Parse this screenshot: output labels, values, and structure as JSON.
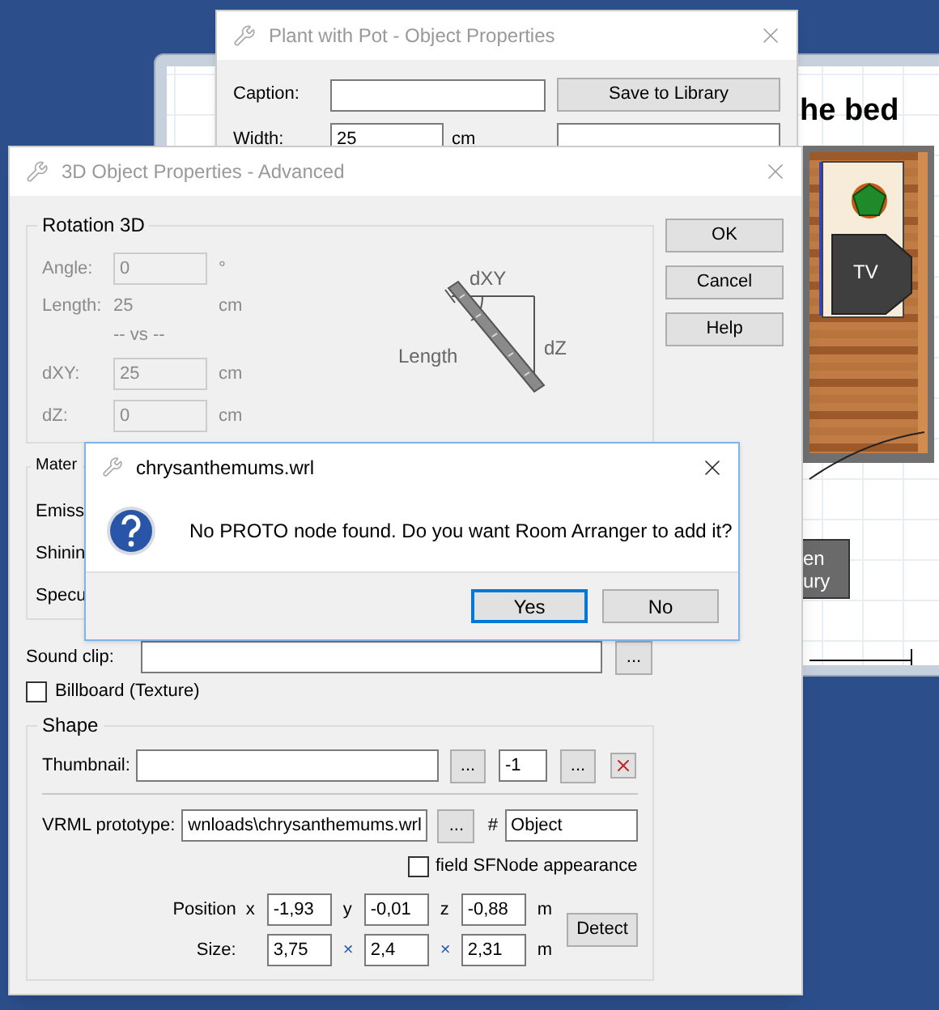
{
  "plan_window": {
    "heading": "he bed",
    "tv_label": "TV",
    "tag_lines": [
      "en",
      "ury"
    ]
  },
  "plant_window": {
    "title": "Plant with Pot - Object Properties",
    "caption_label": "Caption:",
    "save_button": "Save to Library",
    "width_label": "Width:",
    "width_value": "25",
    "width_unit": "cm"
  },
  "advanced_window": {
    "title": "3D Object Properties - Advanced",
    "buttons": [
      "OK",
      "Cancel",
      "Help"
    ],
    "rotation": {
      "title": "Rotation 3D",
      "disabled": true,
      "angle_label": "Angle:",
      "angle_value": "0",
      "angle_unit": "°",
      "length_label": "Length:",
      "length_value": "25",
      "length_unit": "cm",
      "vs": "-- vs --",
      "dxy_label": "dXY:",
      "dxy_value": "25",
      "dxy_unit": "cm",
      "dz_label": "dZ:",
      "dz_value": "0",
      "dz_unit": "cm",
      "diagram_dxy": "dXY",
      "diagram_length": "Length",
      "diagram_dz": "dZ"
    },
    "material": {
      "title": "Mater",
      "rows": [
        "Emiss",
        "Shinin",
        "Specu"
      ]
    },
    "sound_clip": {
      "label": "Sound clip:",
      "browse": "..."
    },
    "billboard": {
      "label": "Billboard (Texture)",
      "checked": false
    },
    "shape": {
      "title": "Shape",
      "thumbnail_label": "Thumbnail:",
      "thumbnail_browse": "...",
      "index": "-1",
      "index_browse": "...",
      "vrml_label": "VRML prototype:",
      "vrml_value": "wnloads\\chrysanthemums.wrl",
      "vrml_browse": "...",
      "hash": "#",
      "node_name": "Object",
      "sfnode": {
        "label": "field SFNode appearance",
        "checked": false
      },
      "position_label": "Position",
      "position": [
        {
          "axis": "x",
          "value": "-1,93"
        },
        {
          "axis": "y",
          "value": "-0,01"
        },
        {
          "axis": "z",
          "value": "-0,88"
        }
      ],
      "position_unit": "m",
      "size_label": "Size:",
      "size": [
        {
          "value": "3,75"
        },
        {
          "sep": "×",
          "value": "2,4"
        },
        {
          "sep": "×",
          "value": "2,31"
        }
      ],
      "size_unit": "m",
      "detect": "Detect"
    }
  },
  "message_box": {
    "title": "chrysanthemums.wrl",
    "text": "No PROTO node found. Do you want Room Arranger to add it?",
    "buttons": [
      {
        "label": "Yes",
        "selected": true
      },
      {
        "label": "No",
        "selected": false
      }
    ]
  }
}
